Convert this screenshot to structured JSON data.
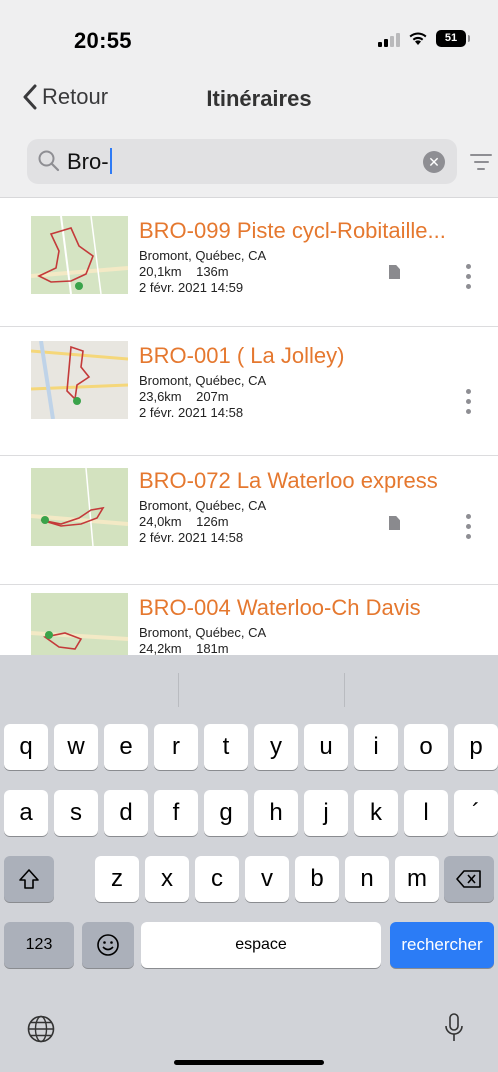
{
  "status_bar": {
    "time": "20:55",
    "battery": "51"
  },
  "nav": {
    "back_label": "Retour",
    "title": "Itinéraires"
  },
  "search": {
    "value": "Bro-"
  },
  "routes": [
    {
      "title": "BRO-099 Piste cycl-Robitaille...",
      "location": "Bromont, Québec, CA",
      "distance": "20,1km",
      "elevation": "136m",
      "date": "2 févr. 2021 14:59",
      "has_document": true
    },
    {
      "title": "BRO-001 ( La Jolley)",
      "location": "Bromont, Québec, CA",
      "distance": "23,6km",
      "elevation": "207m",
      "date": "2 févr. 2021 14:58",
      "has_document": false
    },
    {
      "title": "BRO-072 La Waterloo express",
      "location": "Bromont, Québec, CA",
      "distance": "24,0km",
      "elevation": "126m",
      "date": "2 févr. 2021 14:58",
      "has_document": true
    },
    {
      "title": "BRO-004 Waterloo-Ch Davis",
      "location": "Bromont, Québec, CA",
      "distance": "24,2km",
      "elevation": "181m",
      "date": "",
      "has_document": false
    }
  ],
  "keyboard": {
    "row1": [
      "q",
      "w",
      "e",
      "r",
      "t",
      "y",
      "u",
      "i",
      "o",
      "p"
    ],
    "row2": [
      "a",
      "s",
      "d",
      "f",
      "g",
      "h",
      "j",
      "k",
      "l",
      "´"
    ],
    "row3": [
      "z",
      "x",
      "c",
      "v",
      "b",
      "n",
      "m"
    ],
    "numbers_key": "123",
    "space_key": "espace",
    "action_key": "rechercher"
  },
  "colors": {
    "accent": "#e5782f",
    "key_blue": "#2b7cf6"
  }
}
